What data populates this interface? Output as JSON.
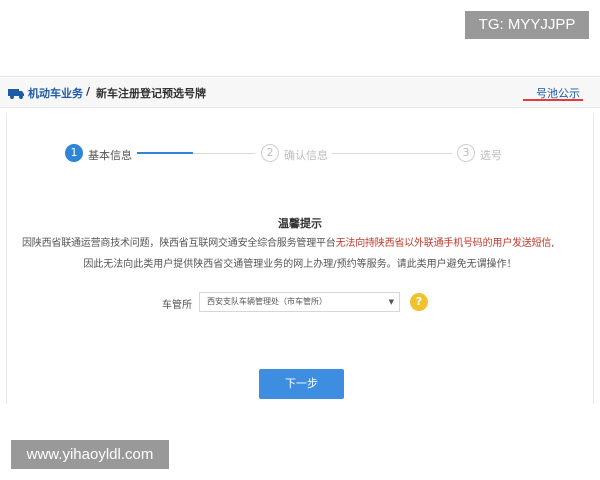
{
  "watermark_top": "TG: MYYJJPP",
  "watermark_bottom": "www.yihaoyldl.com",
  "header": {
    "section": "机动车业务",
    "separator": "/",
    "title": "新车注册登记预选号牌",
    "pool_link": "号池公示",
    "icon": "car-icon"
  },
  "steps": [
    {
      "number": "1",
      "label": "基本信息",
      "state": "active"
    },
    {
      "number": "2",
      "label": "确认信息",
      "state": "inactive"
    },
    {
      "number": "3",
      "label": "选号",
      "state": "inactive"
    }
  ],
  "notice": {
    "title": "温馨提示",
    "line1_prefix": "因陕西省联通运营商技术问题，陕西省互联网交通安全综合服务管理平台",
    "line1_highlight": "无法向持陕西省以外联通手机号码的用户发送短信",
    "line1_suffix": ",",
    "line2": "因此无法向此类用户提供陕西省交通管理业务的网上办理/预约等服务。请此类用户避免无谓操作！"
  },
  "form": {
    "office_label": "车管所",
    "office_value": "西安支队车辆管理处（市车管所）",
    "help_icon": "?"
  },
  "next_button": "下一步",
  "colors": {
    "primary": "#3d8ee0",
    "link": "#1f5aa6",
    "highlight": "#c0392b",
    "help": "#f2c12e"
  }
}
